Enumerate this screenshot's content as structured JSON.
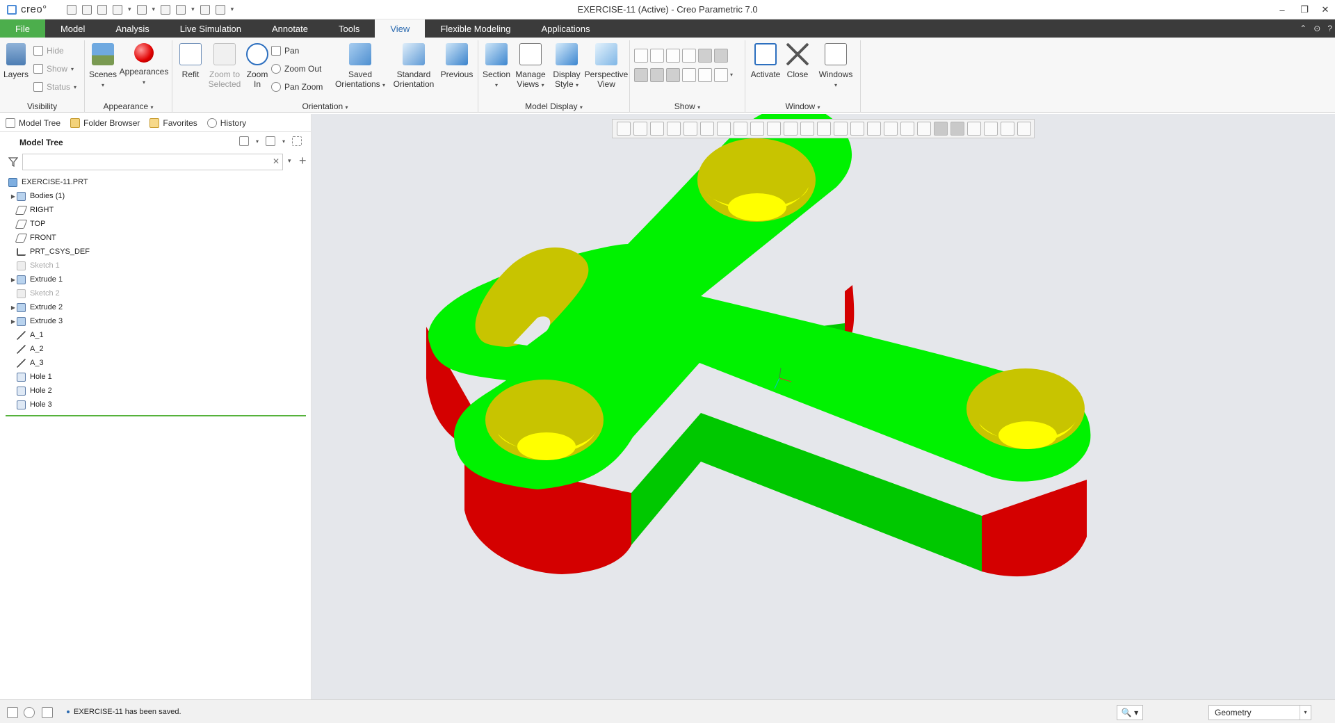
{
  "app": {
    "logo_text": "creo°",
    "window_title": "EXERCISE-11 (Active) - Creo Parametric 7.0",
    "win_min": "–",
    "win_restore": "❐",
    "win_close": "✕"
  },
  "ribbon_tabs": [
    {
      "label": "File"
    },
    {
      "label": "Model"
    },
    {
      "label": "Analysis"
    },
    {
      "label": "Live Simulation"
    },
    {
      "label": "Annotate"
    },
    {
      "label": "Tools"
    },
    {
      "label": "View"
    },
    {
      "label": "Flexible Modeling"
    },
    {
      "label": "Applications"
    }
  ],
  "ribbon_right": {
    "up": "⌃",
    "pin": "⊙",
    "help": "?"
  },
  "ribbon": {
    "visibility": {
      "label": "Visibility",
      "layers": "Layers",
      "hide": "Hide",
      "show": "Show",
      "status": "Status"
    },
    "appearance": {
      "label": "Appearance",
      "scenes": "Scenes",
      "appearances": "Appearances"
    },
    "orientation": {
      "label": "Orientation",
      "refit": "Refit",
      "zoom_to_selected_1": "Zoom to",
      "zoom_to_selected_2": "Selected",
      "zoom_in_1": "Zoom",
      "zoom_in_2": "In",
      "pan": "Pan",
      "zoom_out": "Zoom Out",
      "pan_zoom": "Pan Zoom",
      "saved_1": "Saved",
      "saved_2": "Orientations",
      "standard_1": "Standard",
      "standard_2": "Orientation",
      "previous": "Previous"
    },
    "model_display": {
      "label": "Model Display",
      "section": "Section",
      "manage_1": "Manage",
      "manage_2": "Views",
      "display_1": "Display",
      "display_2": "Style",
      "perspective_1": "Perspective",
      "perspective_2": "View"
    },
    "show": {
      "label": "Show"
    },
    "window": {
      "label": "Window",
      "activate": "Activate",
      "close": "Close",
      "windows": "Windows"
    }
  },
  "nav_tabs": [
    {
      "label": "Model Tree"
    },
    {
      "label": "Folder Browser"
    },
    {
      "label": "Favorites"
    },
    {
      "label": "History"
    }
  ],
  "model_tree": {
    "header": "Model Tree",
    "search_placeholder": "",
    "nodes": [
      {
        "label": "EXERCISE-11.PRT",
        "icon": "part"
      },
      {
        "label": "Bodies (1)",
        "icon": "feat",
        "expandable": true
      },
      {
        "label": "RIGHT",
        "icon": "plane"
      },
      {
        "label": "TOP",
        "icon": "plane"
      },
      {
        "label": "FRONT",
        "icon": "plane"
      },
      {
        "label": "PRT_CSYS_DEF",
        "icon": "csys"
      },
      {
        "label": "Sketch 1",
        "icon": "sketch",
        "dim": true
      },
      {
        "label": "Extrude 1",
        "icon": "feat",
        "expandable": true
      },
      {
        "label": "Sketch 2",
        "icon": "sketch",
        "dim": true
      },
      {
        "label": "Extrude 2",
        "icon": "feat",
        "expandable": true
      },
      {
        "label": "Extrude 3",
        "icon": "feat",
        "expandable": true
      },
      {
        "label": "A_1",
        "icon": "axis"
      },
      {
        "label": "A_2",
        "icon": "axis"
      },
      {
        "label": "A_3",
        "icon": "axis"
      },
      {
        "label": "Hole 1",
        "icon": "hole"
      },
      {
        "label": "Hole 2",
        "icon": "hole"
      },
      {
        "label": "Hole 3",
        "icon": "hole"
      }
    ]
  },
  "colors": {
    "file_tab": "#4cae4c",
    "tab_bar": "#3b3b3b",
    "part_top": "#00f200",
    "part_side_green": "#00c800",
    "part_side_red": "#d40000",
    "hole_wall": "#c8c400",
    "hole_floor": "#ffff00",
    "graphics_bg": "#e5e7eb"
  },
  "status_bar": {
    "message": "EXERCISE-11 has been saved.",
    "filter_value": "Geometry",
    "binoculars": "🔍 ▾"
  }
}
